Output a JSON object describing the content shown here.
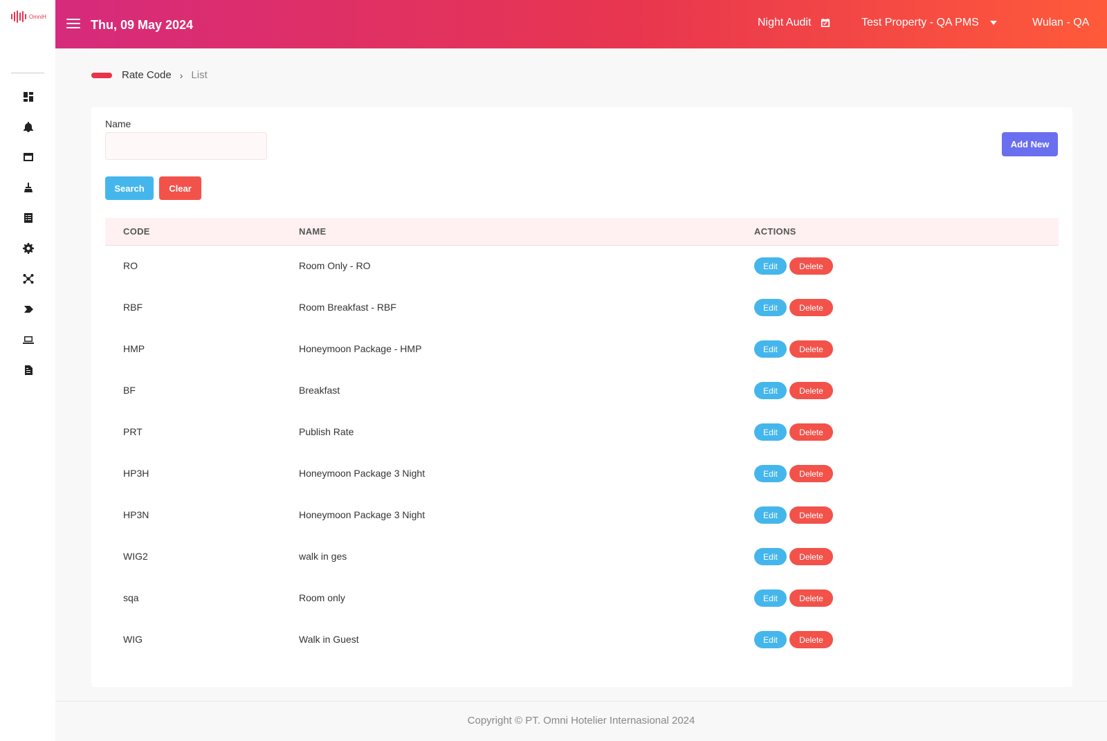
{
  "brand": {
    "logo_text": "OmniH",
    "accent": "#e8334a"
  },
  "sidebar": {
    "icons": [
      {
        "name": "dashboard-icon"
      },
      {
        "name": "bell-icon"
      },
      {
        "name": "window-icon"
      },
      {
        "name": "cleaning-icon"
      },
      {
        "name": "list-icon"
      },
      {
        "name": "gear-icon"
      },
      {
        "name": "network-icon"
      },
      {
        "name": "tag-icon"
      },
      {
        "name": "laptop-icon"
      },
      {
        "name": "report-icon"
      }
    ]
  },
  "header": {
    "date": "Thu, 09 May 2024",
    "night_audit": "Night Audit",
    "property": "Test Property - QA PMS",
    "user": "Wulan - QA",
    "gradient": [
      "#d62a7c",
      "#e8364f",
      "#ff5a3a"
    ]
  },
  "breadcrumb": {
    "section": "Rate Code",
    "current": "List"
  },
  "filter": {
    "label": "Name",
    "value": "",
    "search_label": "Search",
    "clear_label": "Clear",
    "add_label": "Add New"
  },
  "table": {
    "columns": [
      "CODE",
      "NAME",
      "ACTIONS"
    ],
    "edit_label": "Edit",
    "delete_label": "Delete",
    "rows": [
      {
        "code": "RO",
        "name": "Room Only - RO"
      },
      {
        "code": "RBF",
        "name": "Room Breakfast - RBF"
      },
      {
        "code": "HMP",
        "name": "Honeymoon Package - HMP"
      },
      {
        "code": "BF",
        "name": "Breakfast"
      },
      {
        "code": "PRT",
        "name": "Publish Rate"
      },
      {
        "code": "HP3H",
        "name": "Honeymoon Package 3 Night"
      },
      {
        "code": "HP3N",
        "name": "Honeymoon Package 3 Night"
      },
      {
        "code": "WIG2",
        "name": "walk in ges"
      },
      {
        "code": "sqa",
        "name": "Room only"
      },
      {
        "code": "WIG",
        "name": "Walk in Guest"
      }
    ]
  },
  "footer": {
    "copyright": "Copyright © PT. Omni Hotelier Internasional 2024"
  }
}
